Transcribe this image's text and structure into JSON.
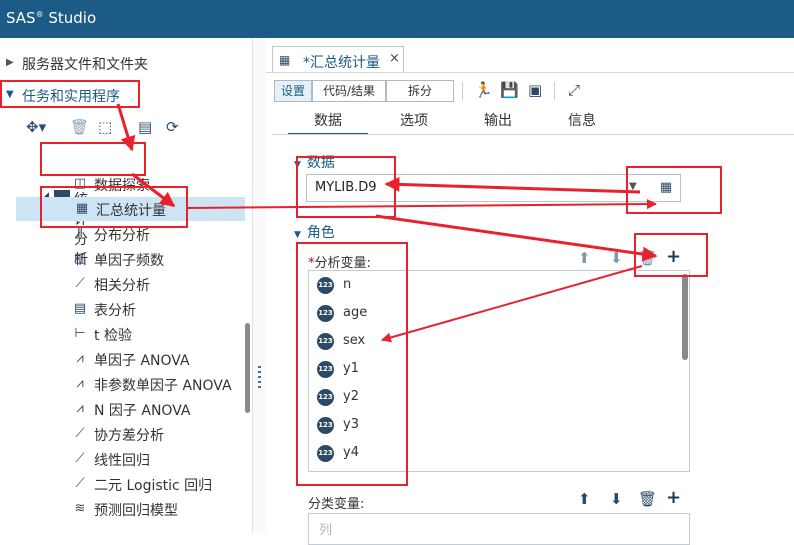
{
  "app": {
    "title": "SAS",
    "title_mark": "®",
    "title_rest": " Studio"
  },
  "left": {
    "sections": [
      {
        "label": "服务器文件和文件夹",
        "state": "collapsed"
      },
      {
        "label": "任务和实用程序",
        "state": "expanded"
      }
    ],
    "tree": {
      "folder": "统计分析",
      "items": [
        {
          "label": "数据探索",
          "icon": "data-explore-icon"
        },
        {
          "label": "汇总统计量",
          "icon": "summary-stats-icon",
          "selected": true
        },
        {
          "label": "分布分析",
          "icon": "distribution-icon"
        },
        {
          "label": "单因子频数",
          "icon": "frequency-icon"
        },
        {
          "label": "相关分析",
          "icon": "correlation-icon"
        },
        {
          "label": "表分析",
          "icon": "table-analysis-icon"
        },
        {
          "label": "t 检验",
          "icon": "t-test-icon"
        },
        {
          "label": "单因子 ANOVA",
          "icon": "anova-icon"
        },
        {
          "label": "非参数单因子 ANOVA",
          "icon": "nonparam-anova-icon"
        },
        {
          "label": "N 因子 ANOVA",
          "icon": "n-anova-icon"
        },
        {
          "label": "协方差分析",
          "icon": "covariance-icon"
        },
        {
          "label": "线性回归",
          "icon": "linear-regression-icon"
        },
        {
          "label": "二元 Logistic 回归",
          "icon": "logistic-icon"
        },
        {
          "label": "预测回归模型",
          "icon": "predictive-model-icon"
        }
      ]
    }
  },
  "right": {
    "tab": {
      "label": "*汇总统计量",
      "close": "×"
    },
    "toolbar": {
      "settings": "设置",
      "code_results": "代码/结果",
      "split": "拆分"
    },
    "subtabs": [
      "数据",
      "选项",
      "输出",
      "信息"
    ],
    "data_section": {
      "label": "数据",
      "dataset": "MYLIB.D9"
    },
    "roles_section": {
      "label": "角色"
    },
    "analysis_vars": {
      "required_mark": "*",
      "label": "分析变量:",
      "items": [
        "n",
        "age",
        "sex",
        "y1",
        "y2",
        "y3",
        "y4"
      ],
      "badge": "123"
    },
    "class_vars": {
      "label": "分类变量:",
      "placeholder": "列"
    }
  },
  "colors": {
    "titlebar": "#1b5b85",
    "accent": "#1b5b85",
    "selected_row": "#cde4f5",
    "annotation": "#e8222c"
  }
}
